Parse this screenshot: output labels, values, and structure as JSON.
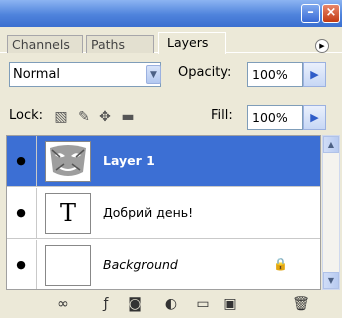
{
  "window": {
    "minimize_glyph": "–",
    "close_glyph": "×"
  },
  "tabs": [
    {
      "label": "Channels"
    },
    {
      "label": "Paths"
    },
    {
      "label": "Layers"
    }
  ],
  "panel_menu_glyph": "▶",
  "blend_mode": {
    "value": "Normal"
  },
  "opacity": {
    "label": "Opacity:",
    "value": "100%"
  },
  "lock": {
    "label": "Lock:"
  },
  "fill": {
    "label": "Fill:",
    "value": "100%"
  },
  "layers": [
    {
      "name": "Layer 1",
      "selected": true,
      "visible": true
    },
    {
      "name": "Добрий день!",
      "type": "text",
      "thumb_glyph": "T",
      "visible": true
    },
    {
      "name": "Background",
      "locked": true,
      "visible": true
    }
  ],
  "icons": {
    "eye": "eye-icon",
    "lock": "lock-icon",
    "link": "link-layers-icon",
    "fx": "layer-style-icon",
    "mask": "mask-icon",
    "adjust": "adjustment-layer-icon",
    "folder": "new-group-icon",
    "new": "new-layer-icon",
    "trash": "delete-layer-icon"
  },
  "colors": {
    "selected": "#3c6fd4",
    "titlebar": "#4f83dc",
    "panel_bg": "#ece9d8"
  }
}
